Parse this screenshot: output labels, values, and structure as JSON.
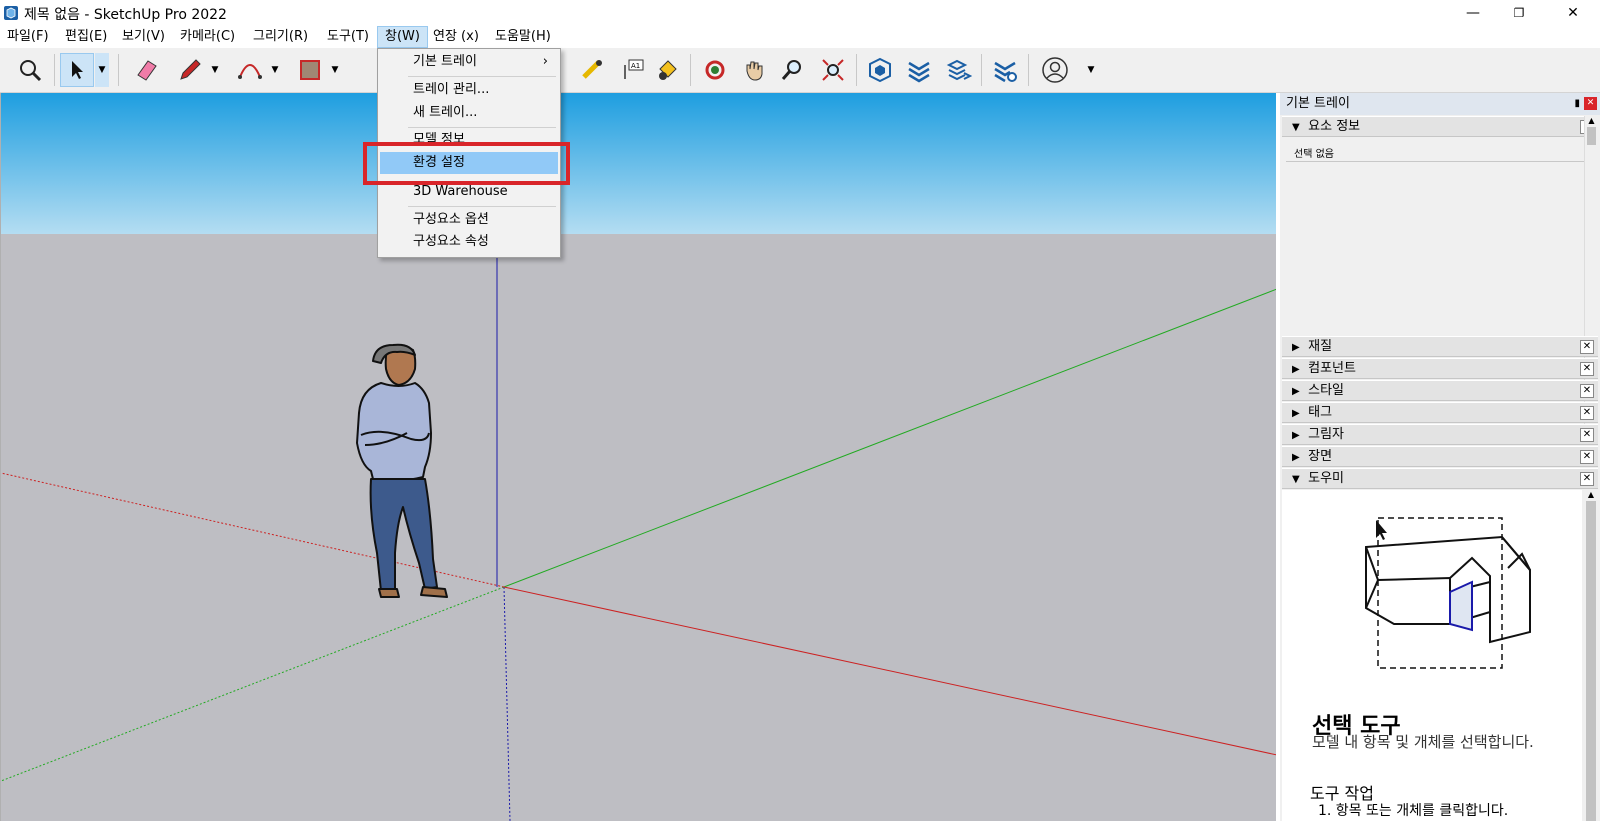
{
  "window": {
    "title": "제목 없음 - SketchUp Pro 2022",
    "controls": {
      "minimize": "—",
      "restore": "❐",
      "close": "✕"
    }
  },
  "menubar": {
    "items": [
      "파일(F)",
      "편집(E)",
      "보기(V)",
      "카메라(C)",
      "그리기(R)",
      "도구(T)",
      "창(W)",
      "연장 (x)",
      "도움말(H)"
    ],
    "active": "창(W)"
  },
  "toolbar": {
    "tools": [
      "zoom-extents-icon",
      "select-icon",
      "eraser-icon",
      "pencil-icon",
      "arc-icon",
      "rectangle-icon",
      "tape-measure-icon",
      "text-icon",
      "paint-bucket-icon",
      "orbit-icon",
      "pan-icon",
      "zoom-icon",
      "zoom-window-icon",
      "warehouse-icon",
      "extension-warehouse-icon",
      "layout-icon",
      "extension-manager-icon",
      "profile-icon"
    ]
  },
  "window_menu": {
    "items": [
      {
        "label": "기본 트레이",
        "submenu": true
      },
      {
        "label": "트레이 관리..."
      },
      {
        "label": "새 트레이..."
      },
      {
        "label": "모델 정보"
      },
      {
        "label": "환경 설정",
        "highlighted": true
      },
      {
        "label": "3D Warehouse"
      },
      {
        "label": "구성요소 옵션"
      },
      {
        "label": "구성요소 속성"
      }
    ],
    "submenu_arrow": "›"
  },
  "tray": {
    "title": "기본 트레이",
    "entity_info": {
      "label": "요소 정보",
      "value": "선택 없음"
    },
    "panels": [
      "재질",
      "컴포넌트",
      "스타일",
      "태그",
      "그림자",
      "장면"
    ],
    "instructor": {
      "label": "도우미",
      "tool_title": "선택 도구",
      "tool_desc": "모델 내 항목 및 개체를 선택합니다.",
      "ops_title": "도구 작업",
      "ops_item": "1. 항목 또는 개체를 클릭합니다."
    }
  },
  "colors": {
    "sky_top": "#1e9ee0",
    "sky_bottom": "#b4ddf2",
    "ground": "#bebec3",
    "axis_red": "#cc2222",
    "axis_green": "#22aa22",
    "axis_blue": "#1a1aaa",
    "highlight_box": "#d9252a",
    "menu_highlight": "#91c9f7"
  }
}
